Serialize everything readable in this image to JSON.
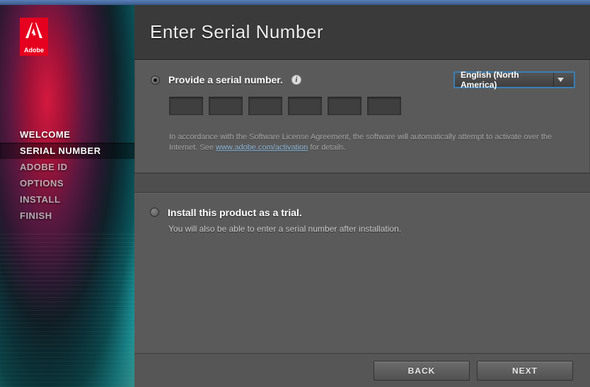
{
  "brand": "Adobe",
  "header": {
    "title": "Enter Serial Number"
  },
  "nav": {
    "items": [
      {
        "label": "WELCOME",
        "state": "done"
      },
      {
        "label": "SERIAL NUMBER",
        "state": "active"
      },
      {
        "label": "ADOBE ID",
        "state": "pending"
      },
      {
        "label": "OPTIONS",
        "state": "pending"
      },
      {
        "label": "INSTALL",
        "state": "pending"
      },
      {
        "label": "FINISH",
        "state": "pending"
      }
    ]
  },
  "option_serial": {
    "label": "Provide a serial number.",
    "checked": true,
    "notice_pre": "In accordance with the Software License Agreement, the software will automatically attempt to activate over the Internet. See ",
    "notice_link": "www.adobe.com/activation",
    "notice_post": " for details."
  },
  "option_trial": {
    "label": "Install this product as a trial.",
    "checked": false,
    "hint": "You will also be able to enter a serial number after installation."
  },
  "language": {
    "selected": "English (North America)"
  },
  "buttons": {
    "back": "BACK",
    "next": "NEXT"
  }
}
